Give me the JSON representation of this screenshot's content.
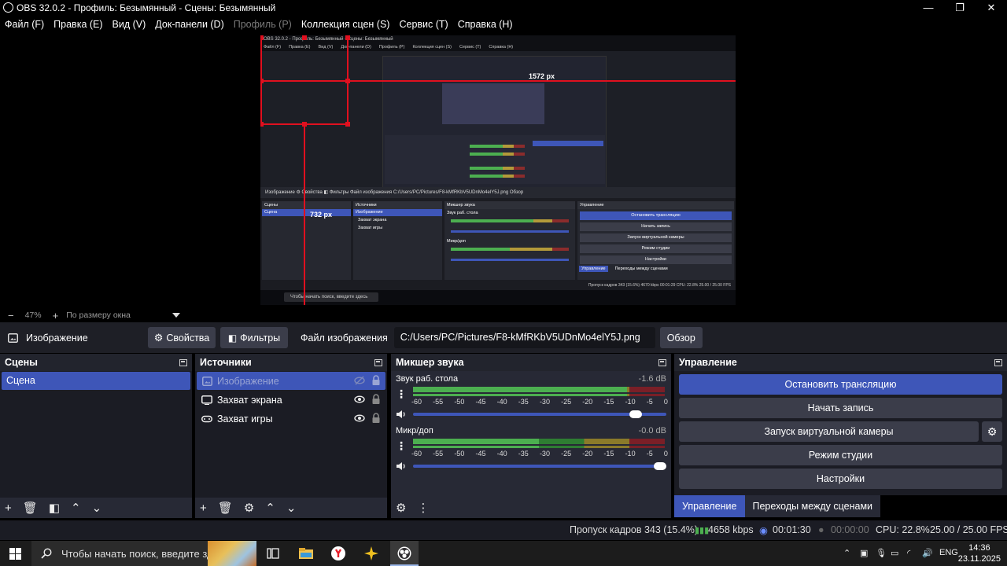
{
  "window": {
    "title": "OBS 32.0.2 - Профиль: Безымянный - Сцены: Безымянный",
    "minimize_glyph": "—",
    "maximize_glyph": "❐",
    "close_glyph": "✕"
  },
  "menu": [
    "Файл (F)",
    "Правка (E)",
    "Вид (V)",
    "Док-панели (D)",
    "Профиль (P)",
    "Коллекция сцен (S)",
    "Сервис (T)",
    "Справка (H)"
  ],
  "preview": {
    "measure_horizontal": "1572 px",
    "measure_vertical": "732 px",
    "inner_title": "OBS 32.0.2 - Профиль: Безымянный - Сцены: Безымянный",
    "inner_menu": [
      "Файл (F)",
      "Правка (E)",
      "Вид (V)",
      "Док-панели (D)",
      "Профиль (P)",
      "Коллекция сцен (S)",
      "Сервис (T)",
      "Справка (H)"
    ],
    "inner_toolbar": "Изображение     ⚙ Свойства     ◧ Фильтры     Файл изображения     C:/Users/PC/Pictures/F8-kMfRKbV5UDnMo4elY5J.png     Обзор",
    "inner_scenes_header": "Сцены",
    "inner_scene": "Сцена",
    "inner_sources_header": "Источники",
    "inner_sources": [
      "Изображение",
      "Захват экрана",
      "Захват игры"
    ],
    "inner_mixer_header": "Микшер звука",
    "inner_mixer_tracks": [
      "Звук раб. стола",
      "Микр/доп"
    ],
    "inner_controls_header": "Управление",
    "inner_controls": [
      "Остановить трансляцию",
      "Начать запись",
      "Запуск виртуальной камеры",
      "Режим студии",
      "Настройки"
    ],
    "inner_tabs": [
      "Управление",
      "Переходы между сценами"
    ],
    "inner_status": "Пропуск кадров 343 (15.6%)   4670 kbps   00:01:29   CPU: 22.8%   25.00 / 25.00 FPS",
    "inner_search": "Чтобы начать поиск, введите здесь"
  },
  "zoom": {
    "minus": "−",
    "value": "47%",
    "plus": "+",
    "mode": "По размеру окна"
  },
  "source_toolbar": {
    "source_name": "Изображение",
    "properties": "Свойства",
    "filters": "Фильтры",
    "file_label": "Файл изображения",
    "file_path": "C:/Users/PC/Pictures/F8-kMfRKbV5UDnMo4elY5J.png",
    "browse": "Обзор"
  },
  "scenes": {
    "header": "Сцены",
    "items": [
      "Сцена"
    ]
  },
  "sources": {
    "header": "Источники",
    "items": [
      {
        "name": "Изображение",
        "icon": "image-icon",
        "visible": false,
        "locked": true
      },
      {
        "name": "Захват экрана",
        "icon": "monitor-icon",
        "visible": true,
        "locked": true
      },
      {
        "name": "Захват игры",
        "icon": "gamepad-icon",
        "visible": true,
        "locked": true
      }
    ]
  },
  "mixer": {
    "header": "Микшер звука",
    "scale": [
      "-60",
      "-55",
      "-50",
      "-45",
      "-40",
      "-35",
      "-30",
      "-25",
      "-20",
      "-15",
      "-10",
      "-5",
      "0"
    ],
    "tracks": [
      {
        "name": "Звук раб. стола",
        "db": "-1.6 dB",
        "volume": 0.9,
        "level": 0.85
      },
      {
        "name": "Микр/доп",
        "db": "-0.0 dB",
        "volume": 1.0,
        "level": 0.5
      }
    ]
  },
  "controls": {
    "header": "Управление",
    "buttons": [
      "Остановить трансляцию",
      "Начать запись",
      "Запуск виртуальной камеры",
      "Режим студии",
      "Настройки"
    ],
    "tabs": [
      "Управление",
      "Переходы между сценами"
    ]
  },
  "status": {
    "dropped_frames": "Пропуск кадров 343 (15.4%)",
    "bitrate": "4658 kbps",
    "stream_time": "00:01:30",
    "record_time": "00:00:00",
    "cpu": "CPU: 22.8%",
    "fps": "25.00 / 25.00 FPS"
  },
  "taskbar": {
    "search_placeholder": "Чтобы начать поиск, введите зде",
    "lang": "ENG",
    "time": "14:36",
    "date": "23.11.2025"
  },
  "colors": {
    "accent": "#3e56b8",
    "guide": "#e0101f",
    "meter_green": "#4caf50",
    "meter_yellow": "#b39a3a",
    "meter_red": "#8b2c2c"
  }
}
